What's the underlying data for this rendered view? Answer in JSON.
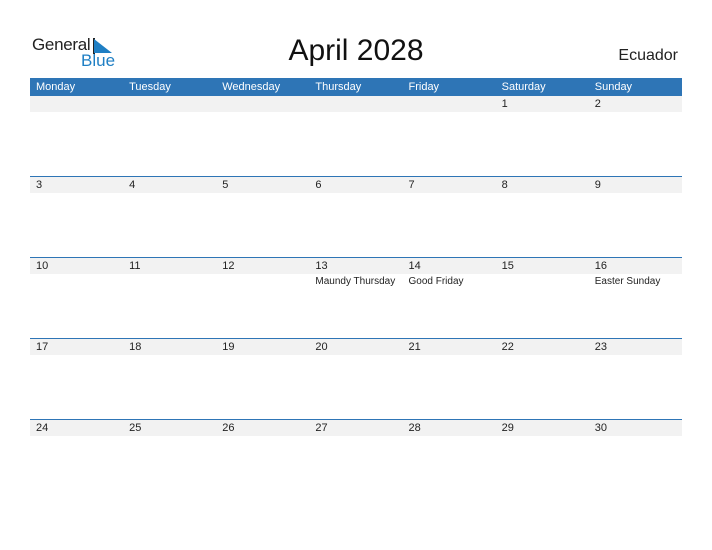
{
  "logo": {
    "line1": "General",
    "line2": "Blue"
  },
  "title": "April 2028",
  "country": "Ecuador",
  "colors": {
    "accent": "#2e75b6",
    "logo_blue": "#1f7fc4",
    "date_band": "#f2f2f2"
  },
  "weekdays": [
    "Monday",
    "Tuesday",
    "Wednesday",
    "Thursday",
    "Friday",
    "Saturday",
    "Sunday"
  ],
  "weeks": [
    {
      "dates": [
        "",
        "",
        "",
        "",
        "",
        "1",
        "2"
      ],
      "holidays": [
        "",
        "",
        "",
        "",
        "",
        "",
        ""
      ]
    },
    {
      "dates": [
        "3",
        "4",
        "5",
        "6",
        "7",
        "8",
        "9"
      ],
      "holidays": [
        "",
        "",
        "",
        "",
        "",
        "",
        ""
      ]
    },
    {
      "dates": [
        "10",
        "11",
        "12",
        "13",
        "14",
        "15",
        "16"
      ],
      "holidays": [
        "",
        "",
        "",
        "Maundy Thursday",
        "Good Friday",
        "",
        "Easter Sunday"
      ]
    },
    {
      "dates": [
        "17",
        "18",
        "19",
        "20",
        "21",
        "22",
        "23"
      ],
      "holidays": [
        "",
        "",
        "",
        "",
        "",
        "",
        ""
      ]
    },
    {
      "dates": [
        "24",
        "25",
        "26",
        "27",
        "28",
        "29",
        "30"
      ],
      "holidays": [
        "",
        "",
        "",
        "",
        "",
        "",
        ""
      ]
    }
  ]
}
